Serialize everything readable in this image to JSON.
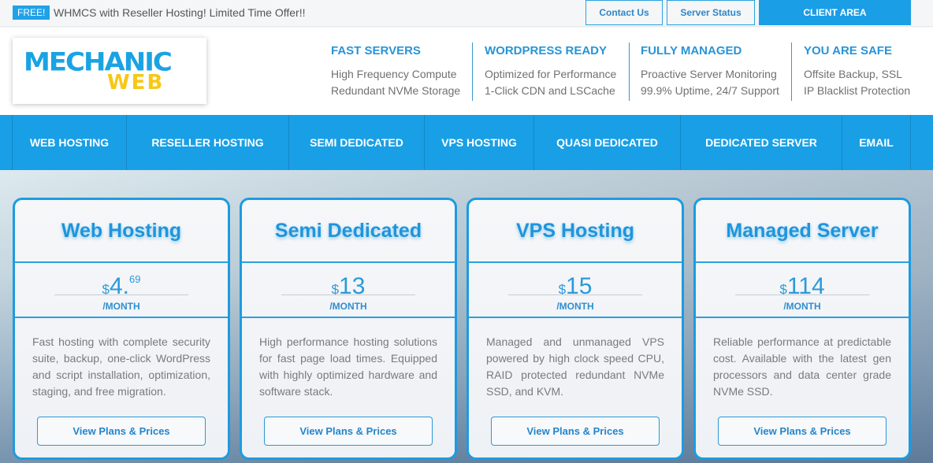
{
  "topbar": {
    "badge": "FREE!",
    "promo": "WHMCS with Reseller Hosting! Limited Time Offer!!",
    "contact_label": "Contact Us",
    "status_label": "Server Status",
    "client_label": "CLIENT AREA"
  },
  "logo": {
    "top": "MECHANIC",
    "bottom": "WEB"
  },
  "features": [
    {
      "title": "FAST SERVERS",
      "line1": "High Frequency Compute",
      "line2": "Redundant NVMe Storage"
    },
    {
      "title": "WORDPRESS READY",
      "line1": "Optimized for Performance",
      "line2": "1-Click CDN and LSCache"
    },
    {
      "title": "FULLY MANAGED",
      "line1": "Proactive Server Monitoring",
      "line2": "99.9% Uptime, 24/7 Support"
    },
    {
      "title": "YOU ARE SAFE",
      "line1": "Offsite Backup, SSL",
      "line2": "IP Blacklist Protection"
    }
  ],
  "nav": [
    "WEB HOSTING",
    "RESELLER HOSTING",
    "SEMI DEDICATED",
    "VPS HOSTING",
    "QUASI DEDICATED",
    "DEDICATED SERVER",
    "EMAIL"
  ],
  "cards": [
    {
      "title": "Web Hosting",
      "currency": "$",
      "amount": "4.",
      "cents": "69",
      "period": "/MONTH",
      "desc": "Fast hosting with complete security suite, backup, one-click WordPress and script installation, optimization, staging, and free migration.",
      "button": "View Plans & Prices"
    },
    {
      "title": "Semi Dedicated",
      "currency": "$",
      "amount": "13",
      "cents": "",
      "period": "/MONTH",
      "desc": "High performance hosting solutions for fast page load times. Equipped with highly optimized hardware and software stack.",
      "button": "View Plans & Prices"
    },
    {
      "title": "VPS Hosting",
      "currency": "$",
      "amount": "15",
      "cents": "",
      "period": "/MONTH",
      "desc": "Managed and unmanaged VPS powered by high clock speed CPU, RAID protected redundant NVMe SSD, and KVM.",
      "button": "View Plans & Prices"
    },
    {
      "title": "Managed Server",
      "currency": "$",
      "amount": "114",
      "cents": "",
      "period": "/MONTH",
      "desc": "Reliable performance at predictable cost. Available with the latest gen processors and data center grade NVMe SSD.",
      "button": "View Plans & Prices"
    }
  ]
}
